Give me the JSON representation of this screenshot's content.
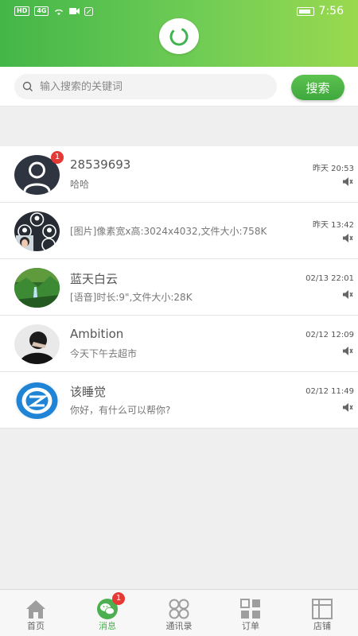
{
  "status_bar": {
    "network": "HD",
    "signal": "4G",
    "time": "7:56"
  },
  "search": {
    "placeholder": "输入搜索的关键词",
    "button_label": "搜索"
  },
  "chats": [
    {
      "name": "28539693",
      "preview": "哈哈",
      "time": "昨天 20:53",
      "unread": "1",
      "avatar": "default-user-avatar"
    },
    {
      "name": "",
      "preview": "[图片]像素宽x高:3024x4032,文件大小:758K",
      "time": "昨天 13:42",
      "avatar": "group-avatar"
    },
    {
      "name": "蓝天白云",
      "preview": "[语音]时长:9\",文件大小:28K",
      "time": "02/13 22:01",
      "avatar": "landscape-photo-avatar"
    },
    {
      "name": "Ambition",
      "preview": "今天下午去超市",
      "time": "02/12 12:09",
      "avatar": "person-photo-avatar"
    },
    {
      "name": "该睡觉",
      "preview": "你好，有什么可以帮你?",
      "time": "02/12 11:49",
      "avatar": "blue-logo-avatar"
    }
  ],
  "nav": {
    "items": [
      {
        "label": "首页",
        "icon": "home-icon"
      },
      {
        "label": "消息",
        "icon": "chat-icon",
        "badge": "1",
        "active": true
      },
      {
        "label": "通讯录",
        "icon": "contacts-icon"
      },
      {
        "label": "订单",
        "icon": "orders-icon"
      },
      {
        "label": "店铺",
        "icon": "store-icon"
      }
    ]
  },
  "colors": {
    "brand_green": "#4caf50",
    "badge_red": "#e53935",
    "header_gradient_start": "#43b648",
    "header_gradient_end": "#9ad94f"
  }
}
